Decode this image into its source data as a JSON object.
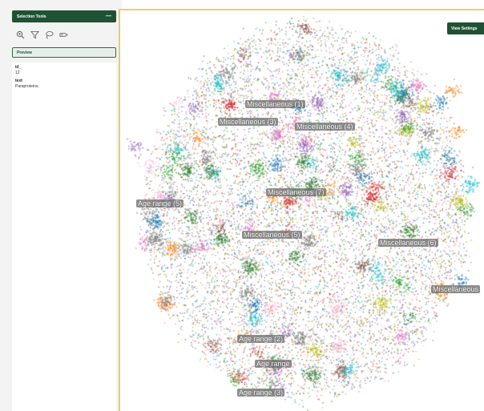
{
  "sidebar": {
    "title": "Selection Tools",
    "collapse_symbol": "—",
    "tools": [
      {
        "icon": "zoom-in-icon"
      },
      {
        "icon": "filter-icon"
      },
      {
        "icon": "lasso-icon"
      },
      {
        "icon": "tag-icon"
      }
    ],
    "preview_label": "Preview",
    "fields": [
      {
        "label": "id_",
        "value": "12"
      },
      {
        "label": "text",
        "value": "Paraproteins."
      }
    ]
  },
  "plot": {
    "view_settings_label": "View Settings",
    "cluster_labels": [
      "Miscellaneous (1)",
      "Miscellaneous (3)",
      "Miscellaneous (4)",
      "Miscellaneous (7)",
      "Age range (5)",
      "Miscellaneous (5)",
      "Miscellaneous (6)",
      "Miscellaneous",
      "Age range (2)",
      "Age range",
      "Age range (3)"
    ],
    "point_colors": [
      "#2e7d32",
      "#1f77b4",
      "#e377c2",
      "#ff7f0e",
      "#d62728",
      "#17becf",
      "#9467bd",
      "#8c564b",
      "#bcbd22",
      "#7f7f7f",
      "#f7b6d2",
      "#2ca02c"
    ],
    "frame_color": "#f3c76a",
    "accent": "#1f5234"
  }
}
